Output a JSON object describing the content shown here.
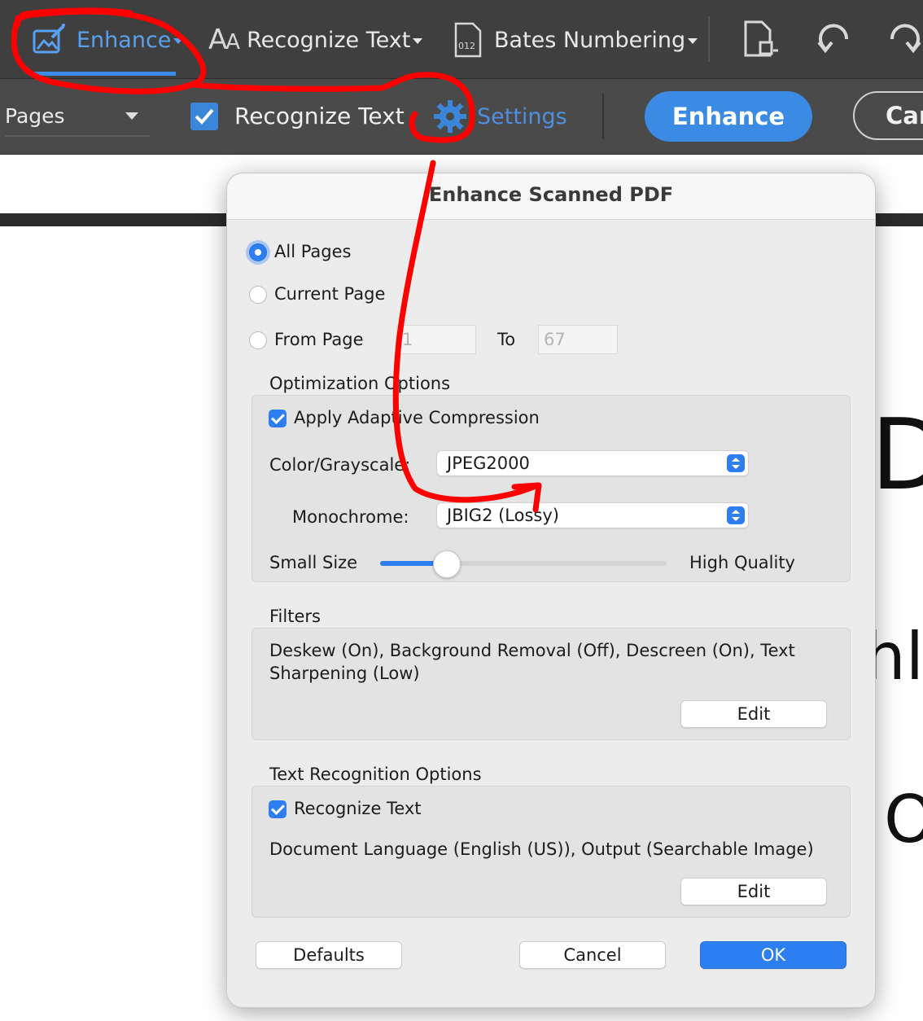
{
  "toolbar": {
    "enhance_label": "Enhance",
    "recognize_text_label": "Recognize Text",
    "bates_label": "Bates Numbering",
    "icons": [
      "enhance-icon",
      "text-icon",
      "bates-icon",
      "page-icon",
      "undo-icon",
      "redo-icon"
    ]
  },
  "subtoolbar": {
    "pages_select": "Pages",
    "recognize_text_label": "Recognize Text",
    "settings_label": "Settings",
    "enhance_button": "Enhance",
    "cancel_button": "Car"
  },
  "document": {
    "glyph_1": "D",
    "glyph_2": "hly",
    "glyph_3": "O"
  },
  "dialog": {
    "title": "Enhance Scanned PDF",
    "range": {
      "all_pages": "All Pages",
      "current_page": "Current Page",
      "from_page": "From Page",
      "from_value": "1",
      "to_label": "To",
      "to_value": "67",
      "selected": "All Pages"
    },
    "optimization": {
      "heading": "Optimization Options",
      "adaptive_label": "Apply Adaptive Compression",
      "adaptive_checked": true,
      "color_label": "Color/Grayscale:",
      "color_value": "JPEG2000",
      "mono_label": "Monochrome:",
      "mono_value": "JBIG2 (Lossy)",
      "small_label": "Small Size",
      "high_label": "High Quality",
      "quality_level": 0.23
    },
    "filters": {
      "heading": "Filters",
      "summary": "Deskew (On), Background Removal (Off), Descreen (On), Text Sharpening (Low)",
      "edit": "Edit"
    },
    "text_recognition": {
      "heading": "Text Recognition Options",
      "recognize_label": "Recognize Text",
      "recognize_checked": true,
      "summary": "Document Language (English (US)), Output (Searchable Image)",
      "edit": "Edit"
    },
    "buttons": {
      "defaults": "Defaults",
      "cancel": "Cancel",
      "ok": "OK"
    }
  },
  "colors": {
    "accent": "#2d7ef0",
    "toolbar_bg": "#3f3f3f",
    "annotation": "#ff0000"
  }
}
